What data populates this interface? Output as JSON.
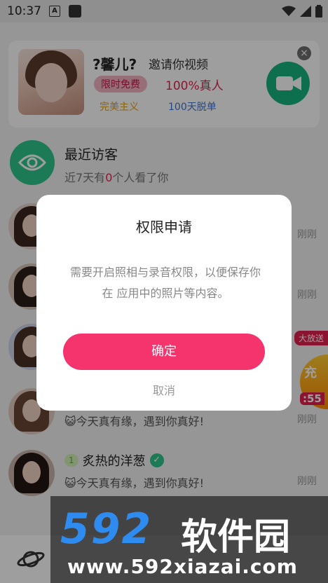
{
  "status_bar": {
    "time": "10:37",
    "notif_a": "A"
  },
  "invite_card": {
    "name": "?馨儿?",
    "invite_text": "邀请你视频",
    "tag_free": "限时免费",
    "tag_real": "100%真人",
    "tag_a": "完美主义",
    "tag_b": "100天脱单",
    "close": "×"
  },
  "visitors": {
    "title": "最近访客",
    "sub_prefix": "近7天有",
    "sub_count": "0",
    "sub_suffix": "个人看了你"
  },
  "messages": [
    {
      "time": "刚刚"
    },
    {
      "time": "刚刚"
    },
    {
      "time": ""
    },
    {
      "time": "刚刚",
      "text": "😺今天真有缘，遇到你真好!"
    },
    {
      "time": "刚刚",
      "name": "炙热的洋葱",
      "level": "1",
      "verify": "✓",
      "text": "😺今天真有缘，遇到你真好!"
    }
  ],
  "promo": {
    "tag": "大放送",
    "label": "充",
    "countdown": ":55"
  },
  "dialog": {
    "title": "权限申请",
    "body": "需要开启照相与录音权限，以便保存你在 应用中的照片等内容。",
    "confirm": "确定",
    "cancel": "取消"
  },
  "watermark": {
    "logo": "592",
    "cn": "软件园",
    "url": "www.592xiazai.com"
  }
}
